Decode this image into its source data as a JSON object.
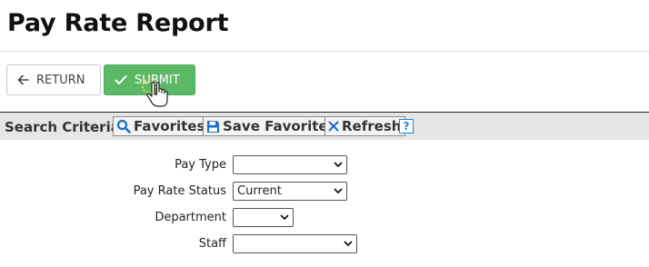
{
  "page": {
    "title": "Pay Rate Report"
  },
  "actions": {
    "return_label": "RETURN",
    "submit_label": "SUBMIT"
  },
  "criteria": {
    "label": "Search Criteria",
    "favorites_label": "Favorites",
    "save_favorites_label": "Save Favorites",
    "refresh_label": "Refresh",
    "help_label": "?"
  },
  "form": {
    "fields": [
      {
        "label": "Pay Type",
        "value": ""
      },
      {
        "label": "Pay Rate Status",
        "value": "Current"
      },
      {
        "label": "Department",
        "value": ""
      },
      {
        "label": "Staff",
        "value": ""
      }
    ]
  },
  "colors": {
    "submit_green": "#5cb865",
    "help_blue": "#1e88d8",
    "save_icon_blue": "#1c6fc4",
    "criteria_bg": "#e6e6e6"
  },
  "icons": {
    "return": "arrow-left-icon",
    "submit": "checkmark-icon",
    "favorites": "search-icon",
    "save_favorites": "floppy-disk-icon",
    "refresh": "close-x-icon",
    "help": "question-mark-icon",
    "cursor": "hand-pointer-cursor-icon"
  }
}
